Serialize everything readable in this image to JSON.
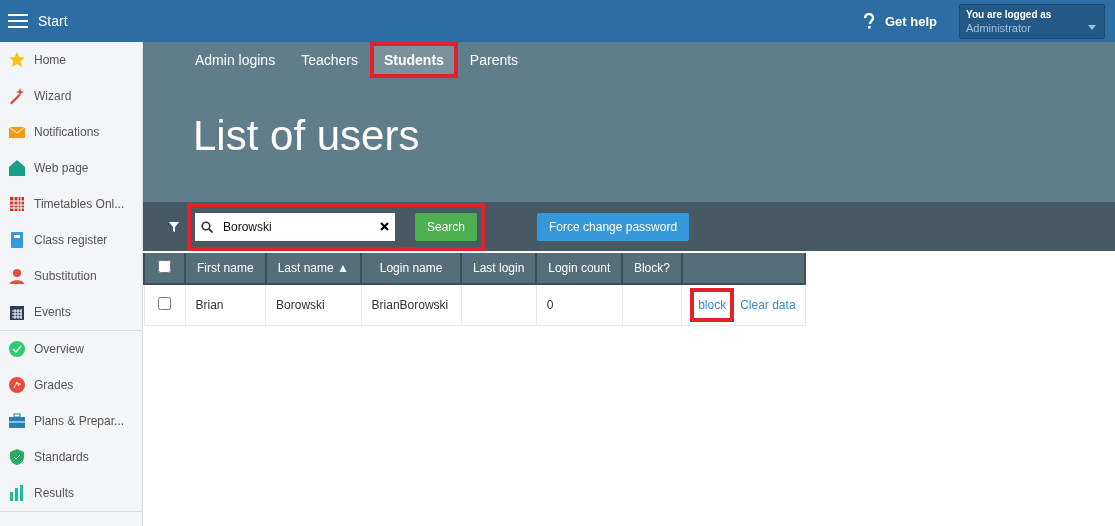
{
  "topbar": {
    "title": "Start",
    "help": "Get help",
    "account": {
      "label": "You are logged as",
      "user": "Administrator"
    }
  },
  "sidebar": {
    "groups": [
      [
        {
          "label": "Home"
        },
        {
          "label": "Wizard"
        },
        {
          "label": "Notifications"
        },
        {
          "label": "Web page"
        },
        {
          "label": "Timetables Onl..."
        },
        {
          "label": "Class register"
        },
        {
          "label": "Substitution"
        },
        {
          "label": "Events"
        }
      ],
      [
        {
          "label": "Overview"
        },
        {
          "label": "Grades"
        },
        {
          "label": "Plans & Prepar..."
        },
        {
          "label": "Standards"
        },
        {
          "label": "Results"
        }
      ]
    ]
  },
  "tabs": [
    {
      "label": "Admin logins",
      "selected": false,
      "highlighted": false
    },
    {
      "label": "Teachers",
      "selected": false,
      "highlighted": false
    },
    {
      "label": "Students",
      "selected": true,
      "highlighted": true
    },
    {
      "label": "Parents",
      "selected": false,
      "highlighted": false
    }
  ],
  "heading": "List of users",
  "toolbar": {
    "search": {
      "value": "Borowski",
      "highlighted": true
    },
    "search_button": "Search",
    "force_button": "Force change password"
  },
  "table": {
    "all_checked": false,
    "columns": [
      {
        "label": "First name"
      },
      {
        "label": "Last name",
        "sort_mark": "▲"
      },
      {
        "label": "Login name"
      },
      {
        "label": "Last login"
      },
      {
        "label": "Login count"
      },
      {
        "label": "Block?"
      }
    ],
    "rows": [
      {
        "checked": false,
        "cells": [
          "Brian",
          "Borowski",
          "BrianBorowski",
          "",
          "0",
          ""
        ],
        "actions": [
          {
            "label": "block",
            "highlighted": true
          },
          {
            "label": "Clear data",
            "highlighted": false
          }
        ]
      }
    ]
  }
}
